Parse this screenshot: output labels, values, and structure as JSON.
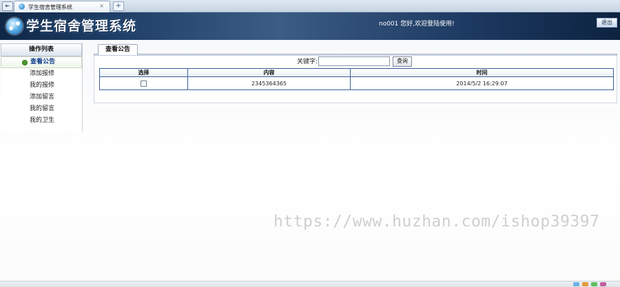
{
  "browser": {
    "tab_title": "学生宿舍管理系统",
    "tab_close": "×",
    "new_tab": "+",
    "nav_glyph": "⇤"
  },
  "header": {
    "app_title": "学生宿舍管理系统",
    "welcome": "no001 您好,欢迎登陆使用!",
    "logout": "退出"
  },
  "sidebar": {
    "title": "操作列表",
    "items": [
      {
        "label": "查看公告",
        "active": true
      },
      {
        "label": "添加报修"
      },
      {
        "label": "我的报修"
      },
      {
        "label": "添加留言"
      },
      {
        "label": "我的留言"
      },
      {
        "label": "我的卫生"
      }
    ]
  },
  "main": {
    "tab_label": "查看公告",
    "search": {
      "label": "关键字:",
      "value": "",
      "button": "查询"
    },
    "table": {
      "headers": [
        "选择",
        "内容",
        "时间"
      ],
      "rows": [
        {
          "content": "2345364365",
          "time": "2014/5/2 16:29:07"
        }
      ]
    }
  },
  "watermark": "https://www.huzhan.com/ishop39397",
  "colors": {
    "header_dark": "#0f2746",
    "table_border": "#3a5f9c",
    "active_menu_text": "#0f3d8a"
  }
}
